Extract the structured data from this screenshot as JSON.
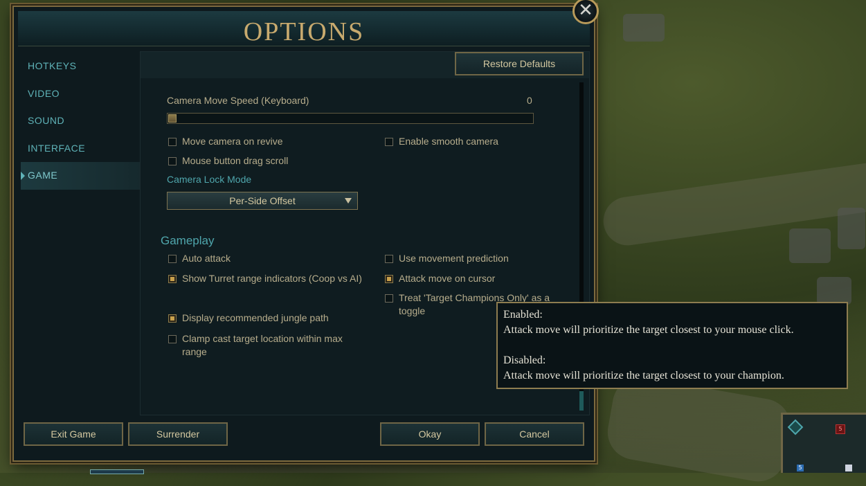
{
  "window": {
    "title": "OPTIONS",
    "close_symbol": "✕"
  },
  "sidebar": {
    "items": [
      {
        "label": "HOTKEYS"
      },
      {
        "label": "VIDEO"
      },
      {
        "label": "SOUND"
      },
      {
        "label": "INTERFACE"
      },
      {
        "label": "GAME",
        "active": true
      }
    ]
  },
  "header": {
    "restore_defaults_label": "Restore Defaults"
  },
  "camera": {
    "speed_label": "Camera Move Speed (Keyboard)",
    "speed_value": "0",
    "options_left": [
      {
        "label": "Move camera on revive",
        "checked": false
      },
      {
        "label": "Mouse button drag scroll",
        "checked": false
      }
    ],
    "options_right": [
      {
        "label": "Enable smooth camera",
        "checked": false
      }
    ],
    "lock_mode_label": "Camera Lock Mode",
    "lock_mode_value": "Per-Side Offset"
  },
  "gameplay": {
    "heading": "Gameplay",
    "left": [
      {
        "label": "Auto attack",
        "checked": false
      },
      {
        "label": "Show Turret range indicators (Coop vs AI)",
        "checked": true
      },
      {
        "label": "Display recommended jungle path",
        "checked": true
      },
      {
        "label": "Clamp cast target location within max range",
        "checked": false
      }
    ],
    "right": [
      {
        "label": "Use movement prediction",
        "checked": false
      },
      {
        "label": "Attack move on cursor",
        "checked": true
      },
      {
        "label": "Treat 'Target Champions Only' as a toggle",
        "checked": false
      }
    ]
  },
  "footer": {
    "exit_label": "Exit Game",
    "surrender_label": "Surrender",
    "okay_label": "Okay",
    "cancel_label": "Cancel"
  },
  "tooltip": {
    "enabled_title": "Enabled:",
    "enabled_text": "Attack move will prioritize the target closest to your mouse click.",
    "disabled_title": "Disabled:",
    "disabled_text": "Attack move will prioritize the target closest to your champion."
  },
  "minimap": {
    "marker_text": "5",
    "corner_text": "5"
  }
}
